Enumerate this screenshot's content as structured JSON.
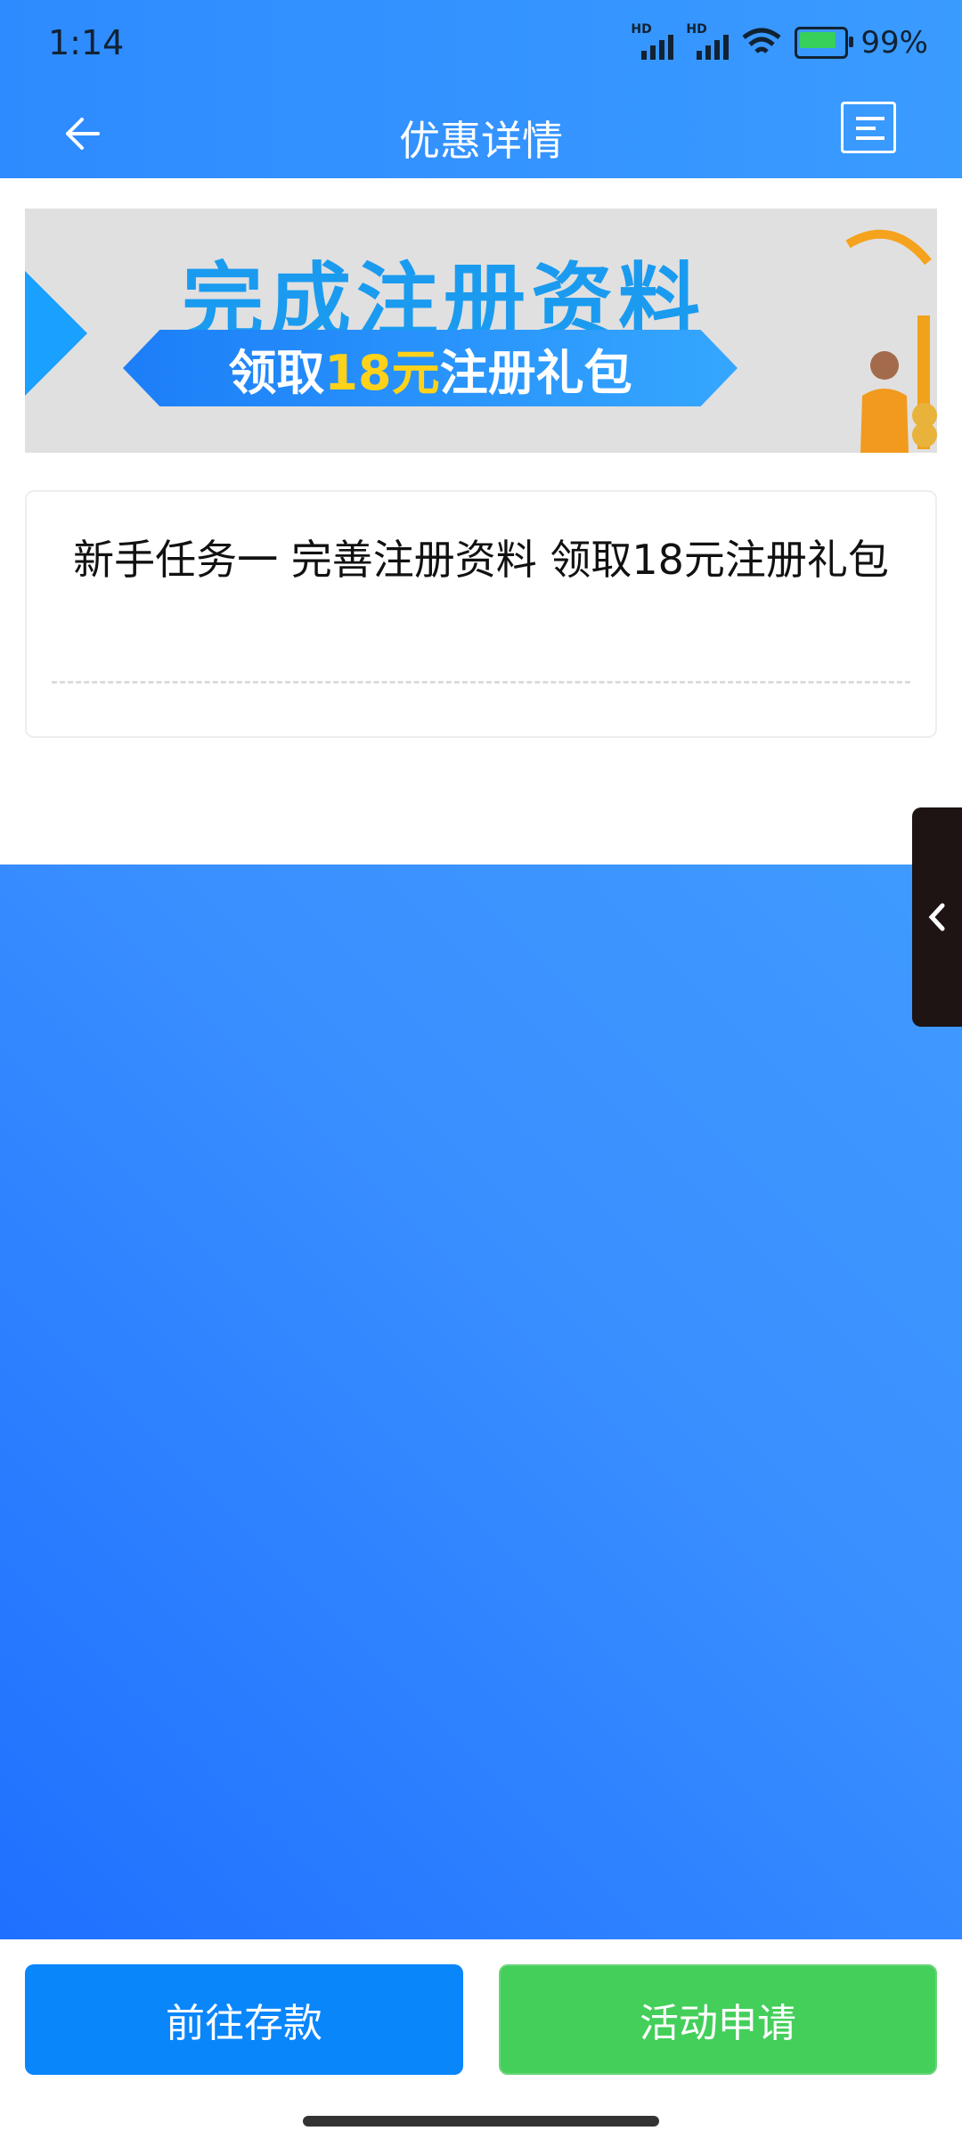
{
  "status_bar": {
    "time": "1:14",
    "battery_percent": "99%",
    "hd1": "HD",
    "hd2": "HD"
  },
  "header": {
    "title": "优惠详情",
    "back_icon": "arrow-left-icon",
    "menu_icon": "menu-icon"
  },
  "banner": {
    "headline": "完成注册资料",
    "ribbon_prefix": "领取",
    "ribbon_amount": "18元",
    "ribbon_suffix": "注册礼包"
  },
  "promotion": {
    "title": "新手任务一 完善注册资料 领取18元注册礼包"
  },
  "actions": {
    "deposit_label": "前往存款",
    "apply_label": "活动申请"
  },
  "colors": {
    "header_blue": "#2e8bff",
    "deposit_button": "#0a86fb",
    "apply_button": "#43cf5a"
  }
}
